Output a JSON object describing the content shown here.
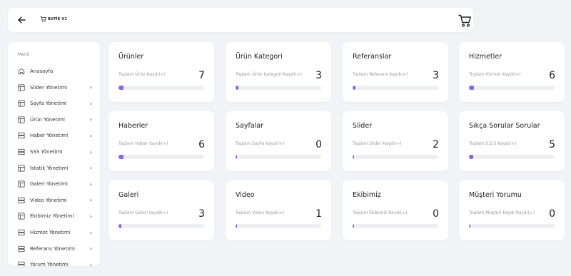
{
  "header": {
    "brand": "BUTİK V1",
    "accent": "#8a63e6"
  },
  "sidebar": {
    "menu_label": "Menü",
    "items": [
      {
        "label": "Anasayfa",
        "icon": "home-icon",
        "has_children": false
      },
      {
        "label": "Slider Yönetimi",
        "icon": "layout-icon",
        "has_children": true
      },
      {
        "label": "Sayfa Yönetimi",
        "icon": "layout-icon",
        "has_children": true
      },
      {
        "label": "Ürün Yönetimi",
        "icon": "layout-icon",
        "has_children": true
      },
      {
        "label": "Haber Yönetimi",
        "icon": "server-icon",
        "has_children": true
      },
      {
        "label": "SSS Yönetimi",
        "icon": "server-icon",
        "has_children": true
      },
      {
        "label": "İstatik Yönetimi",
        "icon": "layout-icon",
        "has_children": true
      },
      {
        "label": "Galeri Yönetimi",
        "icon": "layout-icon",
        "has_children": true
      },
      {
        "label": "Video Yönetimi",
        "icon": "server-icon",
        "has_children": true
      },
      {
        "label": "Ekibimiz Yönetimi",
        "icon": "layout-icon",
        "has_children": true
      },
      {
        "label": "Hizmet Yönetimi",
        "icon": "server-icon",
        "has_children": true
      },
      {
        "label": "Referans Yönetimi",
        "icon": "server-icon",
        "has_children": true
      },
      {
        "label": "Yorum Yönetimi",
        "icon": "server-icon",
        "has_children": true
      }
    ]
  },
  "cards": [
    {
      "title": "Ürünler",
      "subtitle": "Toplam Ürün Kaydı(∞)",
      "count": "7",
      "progress": 0.06
    },
    {
      "title": "Ürün Kategori",
      "subtitle": "Toplam Ürün Kategori Kaydı(∞)",
      "count": "3",
      "progress": 0.03
    },
    {
      "title": "Referanslar",
      "subtitle": "Toplam Referans Kaydı(∞)",
      "count": "3",
      "progress": 0.03
    },
    {
      "title": "Hizmetler",
      "subtitle": "Toplam Hizmet Kaydı(∞)",
      "count": "6",
      "progress": 0.06
    },
    {
      "title": "Haberler",
      "subtitle": "Toplam Haber Kaydı(∞)",
      "count": "6",
      "progress": 0.06
    },
    {
      "title": "Sayfalar",
      "subtitle": "Toplam Sayfa Kaydı(∞)",
      "count": "0",
      "progress": 0.0
    },
    {
      "title": "Slider",
      "subtitle": "Toplam Slider Kaydı(∞)",
      "count": "2",
      "progress": 0.02
    },
    {
      "title": "Sıkça Sorular Sorular",
      "subtitle": "Toplam S.S.S Kaydı(∞)",
      "count": "5",
      "progress": 0.05
    },
    {
      "title": "Galeri",
      "subtitle": "Toplam Galeri Kaydı(∞)",
      "count": "3",
      "progress": 0.03
    },
    {
      "title": "Video",
      "subtitle": "Toplam Video Kaydı(∞)",
      "count": "1",
      "progress": 0.01
    },
    {
      "title": "Ekibimiz",
      "subtitle": "Toplam Ekibimiz Kaydı(∞)",
      "count": "0",
      "progress": 0.0
    },
    {
      "title": "Müşteri Yorumu",
      "subtitle": "Toplam Müşteri Kaydı Kaydı(∞)",
      "count": "0",
      "progress": 0.0
    }
  ]
}
